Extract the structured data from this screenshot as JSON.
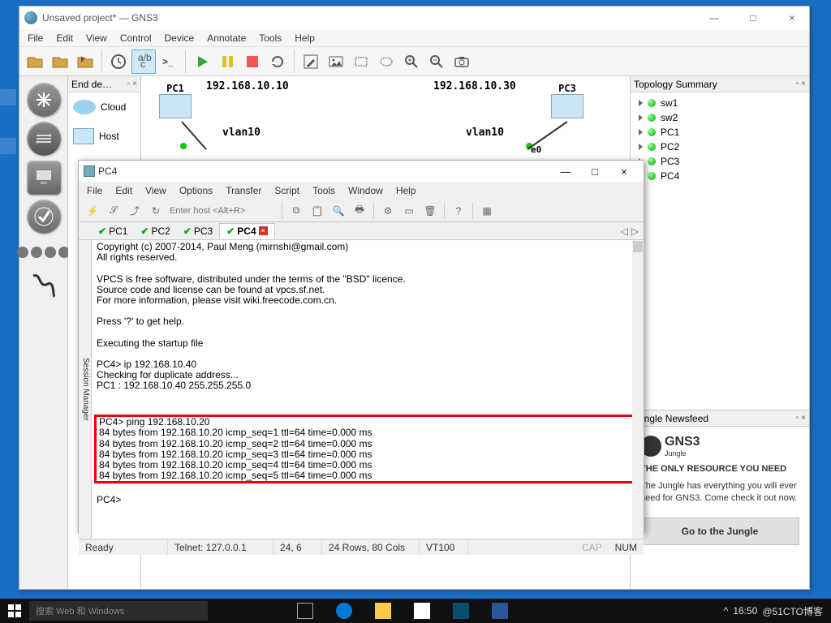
{
  "taskbar": {
    "search_placeholder": "搜索 Web 和 Windows",
    "clock": "16:50",
    "watermark": "@51CTO博客"
  },
  "gns3": {
    "title": "Unsaved project* — GNS3",
    "menu": [
      "File",
      "Edit",
      "View",
      "Control",
      "Device",
      "Annotate",
      "Tools",
      "Help"
    ],
    "end_devices": {
      "title": "End de…",
      "items": [
        "Cloud",
        "Host"
      ]
    },
    "topology": {
      "title": "Topology Summary",
      "nodes": [
        "sw1",
        "sw2",
        "PC1",
        "PC2",
        "PC3",
        "PC4"
      ]
    },
    "canvas": {
      "pc1": "PC1",
      "pc3": "PC3",
      "ip1": "192.168.10.10",
      "ip3": "192.168.10.30",
      "vlan_a": "vlan10",
      "vlan_b": "vlan10",
      "e0": "e0"
    },
    "news": {
      "title": "Jungle Newsfeed",
      "brand": "GNS3",
      "brand2": "Jungle",
      "headline": "THE ONLY RESOURCE YOU NEED",
      "body": "The Jungle has everything you will ever need for GNS3. Come check it out now.",
      "button": "Go to the Jungle"
    }
  },
  "term": {
    "title": "PC4",
    "menu": [
      "File",
      "Edit",
      "View",
      "Options",
      "Transfer",
      "Script",
      "Tools",
      "Window",
      "Help"
    ],
    "host_placeholder": "Enter host <Alt+R>",
    "tabs": [
      "PC1",
      "PC2",
      "PC3",
      "PC4"
    ],
    "active_tab": "PC4",
    "session_mgr": "Session Manager",
    "lines": [
      "Copyright (c) 2007-2014, Paul Meng (mirnshi@gmail.com)",
      "All rights reserved.",
      "",
      "VPCS is free software, distributed under the terms of the \"BSD\" licence.",
      "Source code and license can be found at vpcs.sf.net.",
      "For more information, please visit wiki.freecode.com.cn.",
      "",
      "Press '?' to get help.",
      "",
      "Executing the startup file",
      "",
      "PC4> ip 192.168.10.40",
      "Checking for duplicate address...",
      "PC1 : 192.168.10.40 255.255.255.0",
      ""
    ],
    "box_lines": [
      "PC4> ping 192.168.10.20",
      "84 bytes from 192.168.10.20 icmp_seq=1 ttl=64 time=0.000 ms",
      "84 bytes from 192.168.10.20 icmp_seq=2 ttl=64 time=0.000 ms",
      "84 bytes from 192.168.10.20 icmp_seq=3 ttl=64 time=0.000 ms",
      "84 bytes from 192.168.10.20 icmp_seq=4 ttl=64 time=0.000 ms",
      "84 bytes from 192.168.10.20 icmp_seq=5 ttl=64 time=0.000 ms"
    ],
    "prompt": "PC4>",
    "status": {
      "ready": "Ready",
      "conn": "Telnet: 127.0.0.1",
      "pos": "24,  6",
      "size": "24 Rows, 80 Cols",
      "emu": "VT100",
      "cap": "CAP",
      "num": "NUM"
    }
  }
}
